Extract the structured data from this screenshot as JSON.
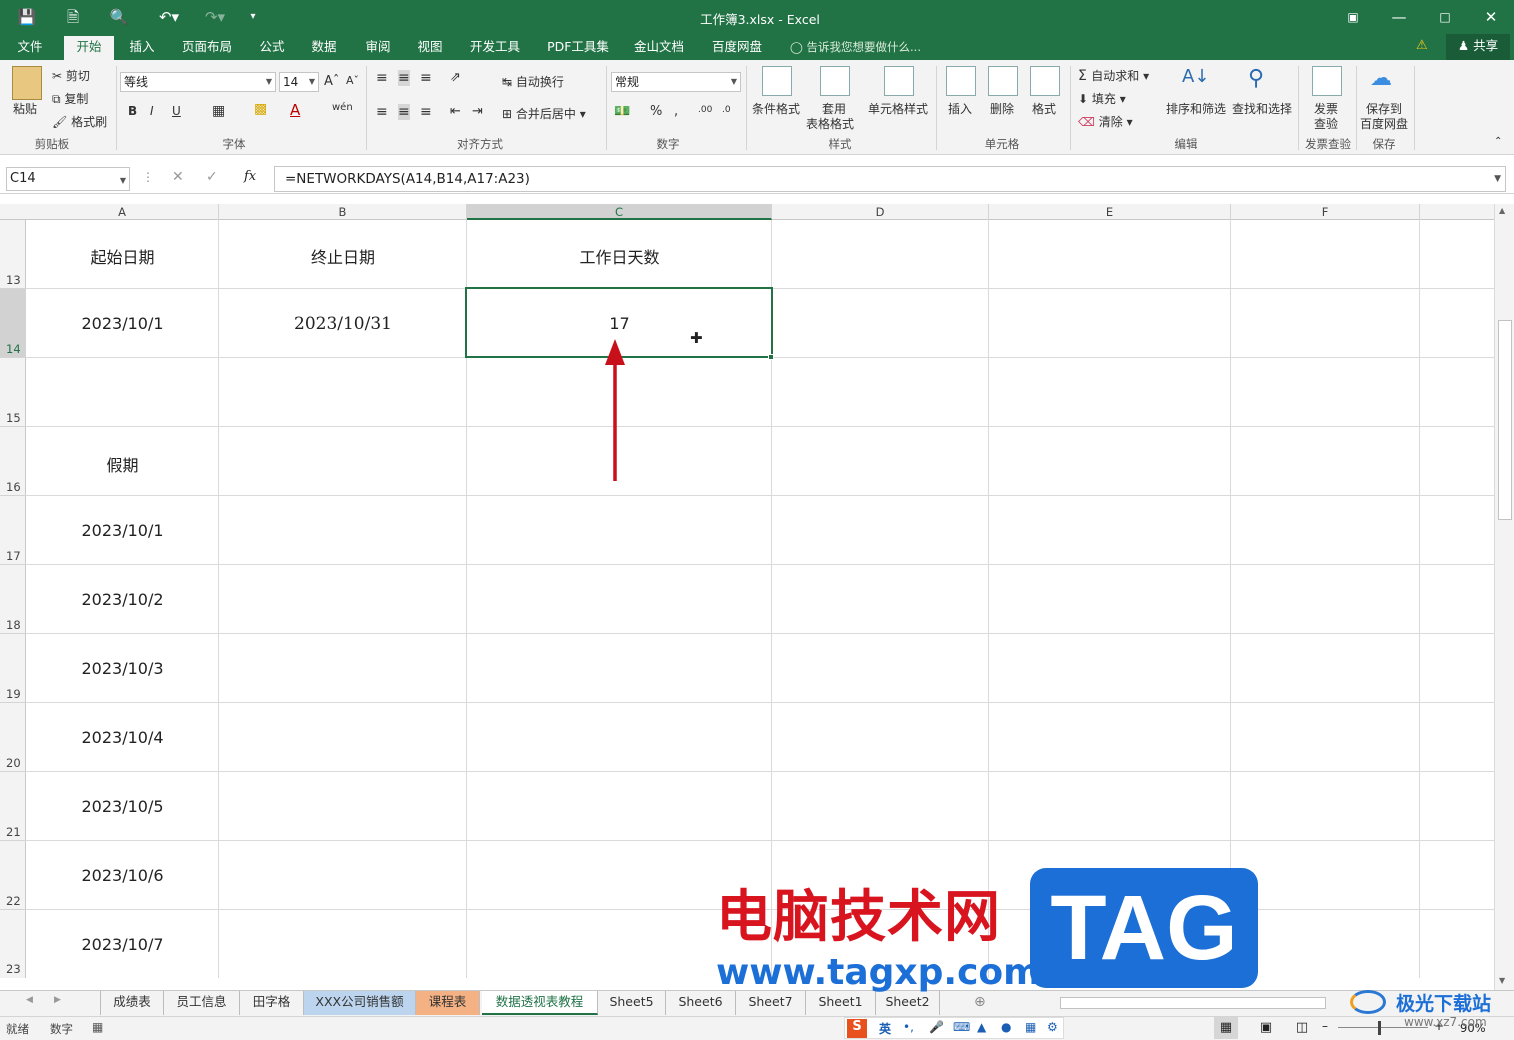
{
  "window": {
    "title": "工作簿3.xlsx - Excel"
  },
  "ribbon_tabs": [
    "文件",
    "开始",
    "插入",
    "页面布局",
    "公式",
    "数据",
    "审阅",
    "视图",
    "开发工具",
    "PDF工具集",
    "金山文档",
    "百度网盘"
  ],
  "tell_me": "告诉我您想要做什么...",
  "share_label": "共享",
  "clipboard": {
    "paste": "粘贴",
    "cut": "剪切",
    "copy": "复制",
    "format_painter": "格式刷",
    "group": "剪贴板"
  },
  "font": {
    "name": "等线",
    "size": "14",
    "group": "字体"
  },
  "alignment": {
    "wrap": "自动换行",
    "merge": "合并后居中",
    "group": "对齐方式"
  },
  "number": {
    "format": "常规",
    "group": "数字"
  },
  "styles": {
    "conditional": "条件格式",
    "table_line1": "套用",
    "table_line2": "表格格式",
    "cell_styles": "单元格样式",
    "group": "样式"
  },
  "cells": {
    "insert": "插入",
    "delete": "删除",
    "format": "格式",
    "group": "单元格"
  },
  "editing": {
    "autosum": "自动求和",
    "fill": "填充",
    "clear": "清除",
    "sort": "排序和筛选",
    "find": "查找和选择",
    "group": "编辑"
  },
  "invoice": {
    "line1": "发票",
    "line2": "查验",
    "group": "发票查验"
  },
  "save": {
    "line1": "保存到",
    "line2": "百度网盘",
    "group": "保存"
  },
  "formula_bar": {
    "name_box": "C14",
    "formula": "=NETWORKDAYS(A14,B14,A17:A23)"
  },
  "columns": [
    "A",
    "B",
    "C",
    "D",
    "E",
    "F"
  ],
  "rows": [
    "13",
    "14",
    "15",
    "16",
    "17",
    "18",
    "19",
    "20",
    "21",
    "22",
    "23"
  ],
  "cells_data": {
    "a13": "起始日期",
    "b13": "终止日期",
    "c13": "工作日天数",
    "a14": "2023/10/1",
    "b14": "2023/10/31",
    "c14": "17",
    "a16": "假期",
    "a17": "2023/10/1",
    "a18": "2023/10/2",
    "a19": "2023/10/3",
    "a20": "2023/10/4",
    "a21": "2023/10/5",
    "a22": "2023/10/6",
    "a23": "2023/10/7"
  },
  "sheet_tabs": [
    "成绩表",
    "员工信息",
    "田字格",
    "XXX公司销售额",
    "课程表",
    "数据透视表教程",
    "Sheet5",
    "Sheet6",
    "Sheet7",
    "Sheet1",
    "Sheet2"
  ],
  "active_sheet": "数据透视表教程",
  "status": {
    "ready": "就绪",
    "mode": "数字",
    "zoom": "90%"
  },
  "watermark": {
    "text1": "电脑技术网",
    "logo": "TAG",
    "url": "www.tagxp.com",
    "site2": "极光下载站",
    "url2": "www.xz7.com"
  },
  "colors": {
    "excel_green": "#217346",
    "arrow_red": "#c8101a",
    "watermark_blue": "#1c6fd6"
  }
}
